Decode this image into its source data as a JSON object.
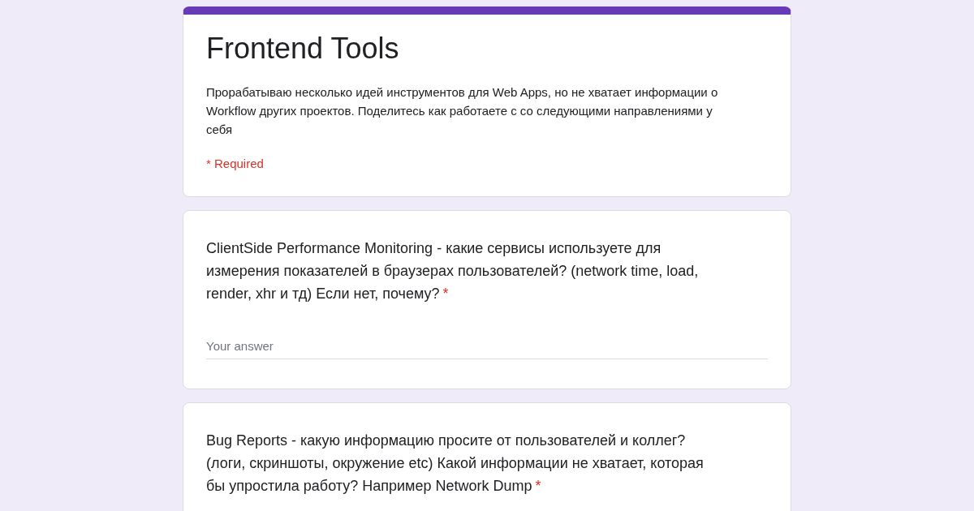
{
  "form": {
    "title": "Frontend Tools",
    "description": "Прорабатываю несколько идей инструментов для Web Apps, но не хватает информации о Workflow других проектов. Поделитесь как работаете с со следующими направлениями у себя",
    "required_note": "* Required"
  },
  "questions": [
    {
      "text": "ClientSide Performance Monitoring - какие сервисы используете для измерения показателей в браузерах пользователей? (network time, load, render, xhr и тд) Если нет, почему?",
      "required": true,
      "required_mark": "*",
      "answer": {
        "placeholder": "Your answer"
      }
    },
    {
      "text": "Bug Reports - какую информацию просите от пользователей и коллег? (логи, скриншоты, окружение etc) Какой информации не хватает, которая бы упростила работу? Например Network Dump",
      "required": true,
      "required_mark": "*"
    }
  ]
}
